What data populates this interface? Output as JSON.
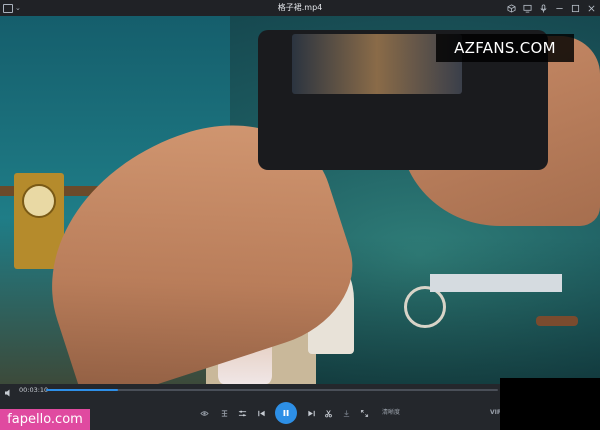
{
  "titlebar": {
    "title": "格子裙.mp4",
    "icons": [
      "cube-icon",
      "monitor-icon",
      "minimize-icon",
      "maximize-icon",
      "close-icon"
    ]
  },
  "video": {
    "watermark": "AZFANS.COM"
  },
  "controls": {
    "current_time": "00:03:10",
    "progress": 0.16,
    "quality_label": "清晰度",
    "vip_label": "VIP",
    "accent_color": "#2d8fe6"
  },
  "overlay": {
    "site_label": "fapello.com"
  }
}
